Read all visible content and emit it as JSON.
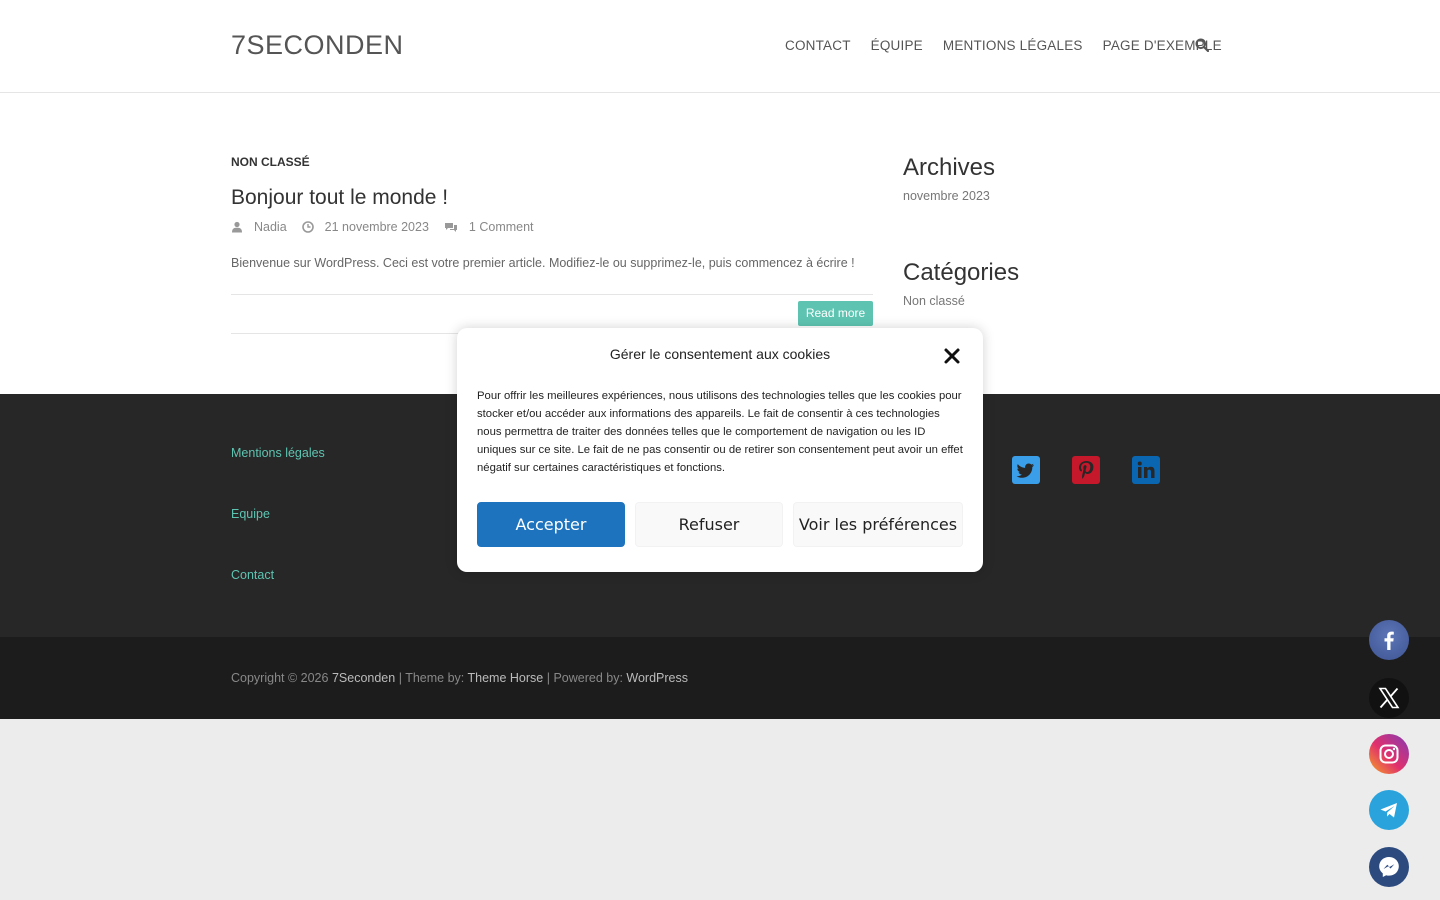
{
  "header": {
    "site_title": "7SECONDEN",
    "nav": [
      "CONTACT",
      "ÉQUIPE",
      "MENTIONS LÉGALES",
      "PAGE D'EXEMPLE"
    ]
  },
  "post": {
    "category": "NON CLASSÉ",
    "title": "Bonjour tout le monde !",
    "author": "Nadia",
    "date": "21 novembre 2023",
    "comments": "1 Comment",
    "excerpt": "Bienvenue sur WordPress. Ceci est votre premier article. Modifiez-le ou supprimez-le, puis commencez à écrire !",
    "read_more": "Read more"
  },
  "sidebar": {
    "archives_title": "Archives",
    "archives_items": [
      "novembre 2023"
    ],
    "categories_title": "Catégories",
    "categories_items": [
      "Non classé"
    ]
  },
  "footer": {
    "links": [
      "Mentions légales",
      "Equipe",
      "Contact"
    ],
    "copyright_prefix": "Copyright © 2026",
    "site_link": "7Seconden",
    "theme_prefix": "| Theme by:",
    "theme_link": "Theme Horse",
    "powered_prefix": "| Powered by:",
    "powered_link": "WordPress",
    "social_colors": {
      "twitter": "#3b9ee8",
      "pinterest": "#c5182a",
      "linkedin": "#0a66b0"
    }
  },
  "cookie_banner": {
    "title": "Gérer le consentement aux cookies",
    "text": "Pour offrir les meilleures expériences, nous utilisons des technologies telles que les cookies pour stocker et/ou accéder aux informations des appareils. Le fait de consentir à ces technologies nous permettra de traiter des données telles que le comportement de navigation ou les ID uniques sur ce site. Le fait de ne pas consentir ou de retirer son consentement peut avoir un effet négatif sur certaines caractéristiques et fonctions.",
    "accept": "Accepter",
    "deny": "Refuser",
    "preferences": "Voir les préférences"
  },
  "share_buttons": [
    "facebook-icon",
    "x-icon",
    "instagram-icon",
    "telegram-icon",
    "messenger-icon"
  ],
  "colors": {
    "accent": "#5ec4b1",
    "accept_button": "#1e73be"
  }
}
